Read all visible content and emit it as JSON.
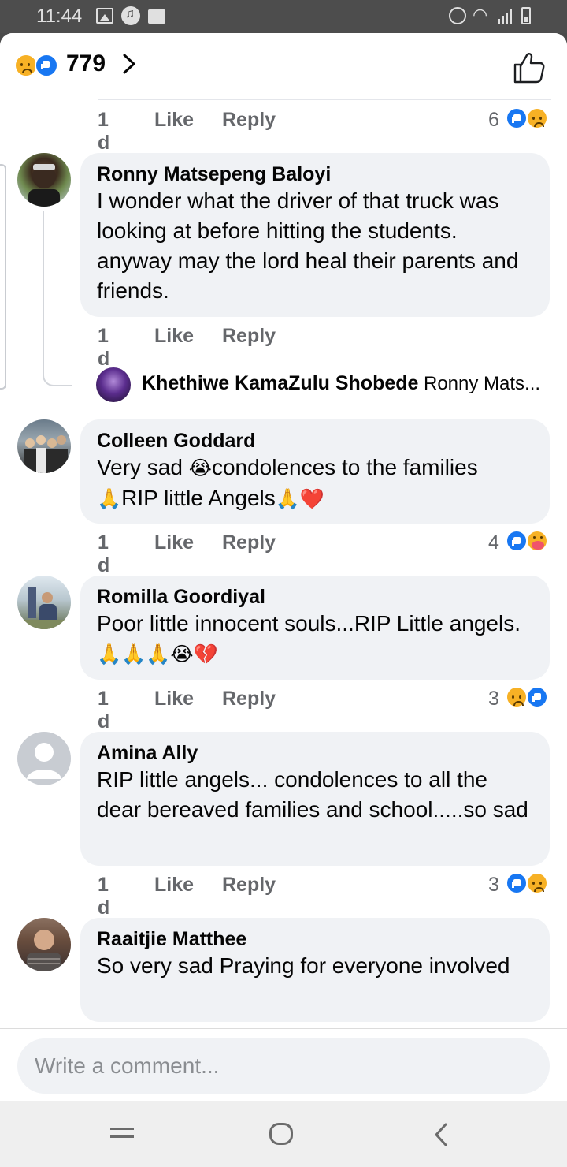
{
  "status_bar": {
    "time": "11:44"
  },
  "header": {
    "reaction_count": "779"
  },
  "comments": [
    {
      "time": "1 d",
      "like": "Like",
      "reply": "Reply",
      "reactions_count": "6"
    },
    {
      "name": "Ronny Matsepeng Baloyi",
      "text": "I wonder what the driver of that truck was looking at before hitting the students. anyway may the lord heal their parents and friends.",
      "time": "1 d",
      "like": "Like",
      "reply": "Reply",
      "reply_preview": {
        "name": "Khethiwe KamaZulu Shobede",
        "snippet": "Ronny Mats..."
      }
    },
    {
      "name": "Colleen Goddard",
      "text_1": "Very sad ",
      "emoji_1": "😭",
      "text_2": "condolences to the families",
      "emoji_2": "🙏",
      "text_3": "RIP little Angels",
      "emoji_3": "🙏❤️",
      "time": "1 d",
      "like": "Like",
      "reply": "Reply",
      "reactions_count": "4"
    },
    {
      "name": "Romilla Goordiyal",
      "text_1": "Poor little innocent souls...RIP Little angels.",
      "emoji_1": "🙏🙏🙏😭💔",
      "time": "1 d",
      "like": "Like",
      "reply": "Reply",
      "reactions_count": "3"
    },
    {
      "name": "Amina Ally",
      "text": "RIP little angels... condolences to all the dear bereaved families and school.....so sad",
      "time": "1 d",
      "like": "Like",
      "reply": "Reply",
      "reactions_count": "3"
    },
    {
      "name": "Raaitjie Matthee",
      "text": "So very sad  Praying for everyone involved"
    }
  ],
  "composer": {
    "placeholder": "Write a comment..."
  }
}
